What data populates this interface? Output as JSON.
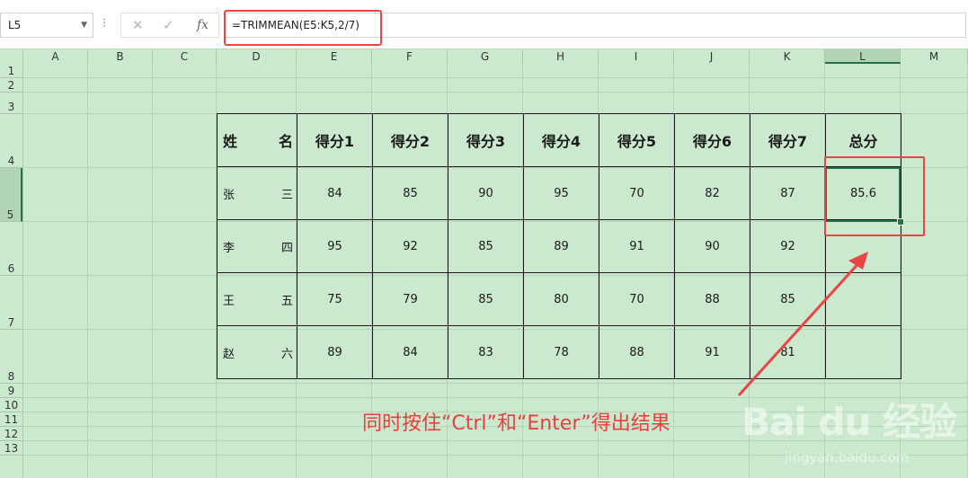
{
  "formula_bar": {
    "name_box": "L5",
    "cancel_icon": "✕",
    "enter_icon": "✓",
    "fx_label": "fx",
    "formula": "=TRIMMEAN(E5:K5,2/7)"
  },
  "columns": [
    "A",
    "B",
    "C",
    "D",
    "E",
    "F",
    "G",
    "H",
    "I",
    "J",
    "K",
    "L",
    "M"
  ],
  "rows": [
    "1",
    "2",
    "3",
    "4",
    "5",
    "6",
    "7",
    "8",
    "9",
    "10",
    "11",
    "12",
    "13"
  ],
  "selected": {
    "column": "L",
    "row": "5"
  },
  "table": {
    "header": {
      "name": [
        "姓",
        "名"
      ],
      "scores": [
        "得分1",
        "得分2",
        "得分3",
        "得分4",
        "得分5",
        "得分6",
        "得分7"
      ],
      "total": "总分"
    },
    "rows": [
      {
        "name": [
          "张",
          "三"
        ],
        "scores": [
          "84",
          "85",
          "90",
          "95",
          "70",
          "82",
          "87"
        ],
        "total": "85.6"
      },
      {
        "name": [
          "李",
          "四"
        ],
        "scores": [
          "95",
          "92",
          "85",
          "89",
          "91",
          "90",
          "92"
        ],
        "total": ""
      },
      {
        "name": [
          "王",
          "五"
        ],
        "scores": [
          "75",
          "79",
          "85",
          "80",
          "70",
          "88",
          "85"
        ],
        "total": ""
      },
      {
        "name": [
          "赵",
          "六"
        ],
        "scores": [
          "89",
          "84",
          "83",
          "78",
          "88",
          "91",
          "81"
        ],
        "total": ""
      }
    ]
  },
  "annotation": {
    "text": "同时按住“Ctrl”和“Enter”得出结果",
    "color": "#e9403f"
  },
  "watermark": {
    "logo": "Bai du 经验",
    "url": "jingyan.baidu.com"
  },
  "colors": {
    "sheet_bg": "#cbe9ce",
    "selection": "#217346",
    "highlight": "#e94545"
  }
}
